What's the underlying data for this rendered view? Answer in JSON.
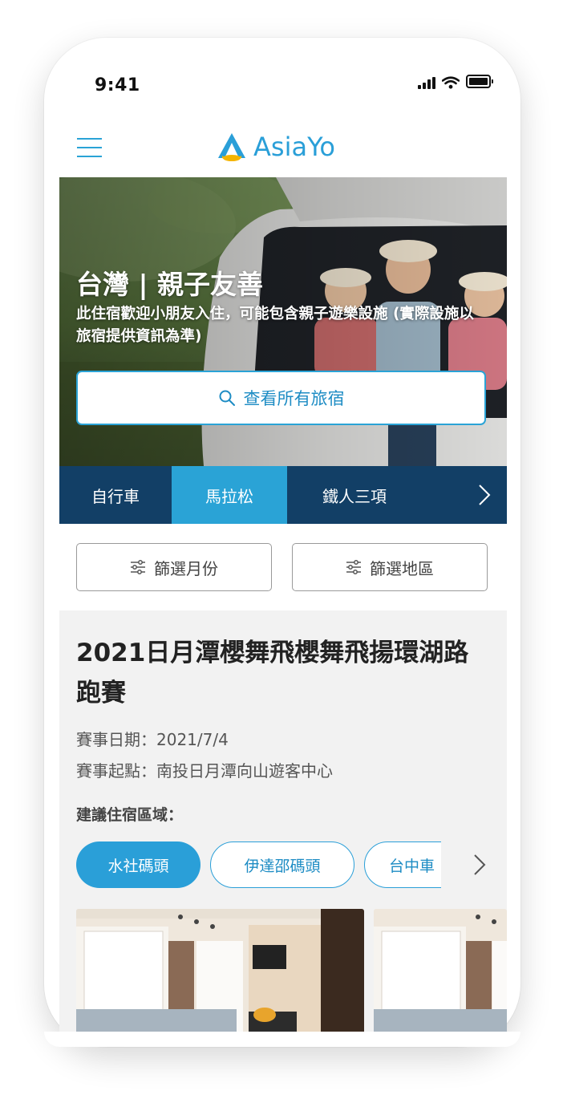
{
  "status_bar": {
    "time": "9:41"
  },
  "header": {
    "brand": "AsiaYo"
  },
  "hero": {
    "title": "台灣 | 親子友善",
    "description": "此住宿歡迎小朋友入住，可能包含親子遊樂設施 (實際設施以旅宿提供資訊為準)",
    "cta_label": "查看所有旅宿"
  },
  "categories": [
    {
      "label": "自行車",
      "active": false
    },
    {
      "label": "馬拉松",
      "active": true
    },
    {
      "label": "鐵人三項",
      "active": false
    }
  ],
  "filters": {
    "month_label": "篩選月份",
    "region_label": "篩選地區"
  },
  "event": {
    "title": "2021日月潭櫻舞飛櫻舞飛揚環湖路跑賽",
    "date_line": "賽事日期：2021/7/4",
    "start_line": "賽事起點：南投日月潭向山遊客中心",
    "area_label": "建議住宿區域：",
    "areas": [
      {
        "label": "水社碼頭",
        "active": true
      },
      {
        "label": "伊達邵碼頭",
        "active": false
      },
      {
        "label": "台中車",
        "active": false
      }
    ]
  },
  "colors": {
    "accent": "#2aa3d6",
    "navy": "#123f66",
    "section_bg": "#f2f2f2"
  },
  "icons": [
    "menu-icon",
    "logo-icon",
    "search-icon",
    "chevron-right-icon",
    "filter-sliders-icon",
    "signal-icon",
    "wifi-icon",
    "battery-icon"
  ]
}
